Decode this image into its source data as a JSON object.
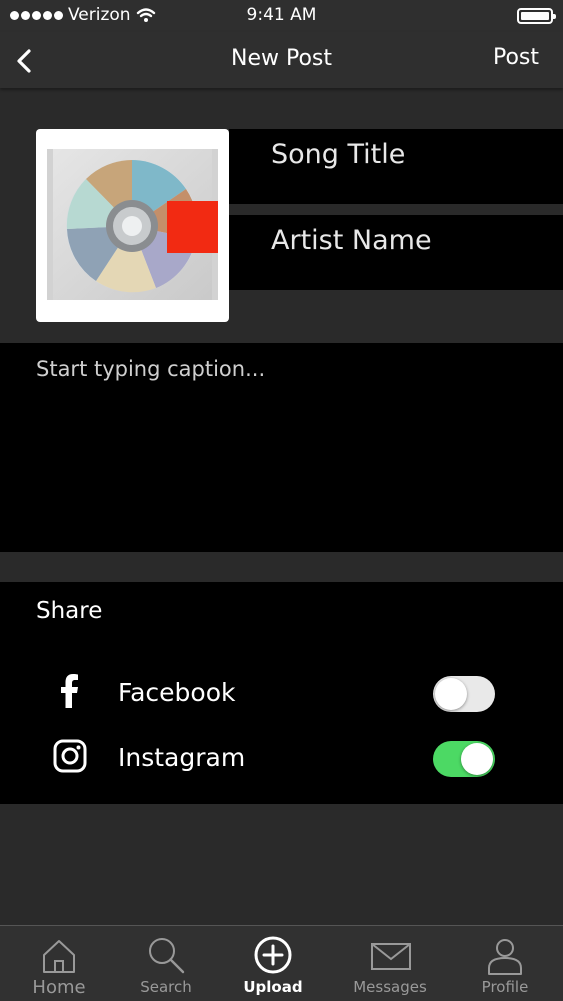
{
  "status_bar": {
    "carrier": "Verizon",
    "time": "9:41 AM",
    "signal_icon": "signal-dots-icon",
    "wifi_icon": "wifi-icon",
    "battery_icon": "battery-icon"
  },
  "nav": {
    "back_icon": "chevron-left-icon",
    "title": "New Post",
    "post_label": "Post"
  },
  "song": {
    "title_placeholder": "Song Title",
    "artist_placeholder": "Artist Name"
  },
  "caption": {
    "placeholder": "Start typing caption..."
  },
  "share": {
    "heading": "Share",
    "items": [
      {
        "label": "Facebook",
        "icon": "facebook-icon",
        "enabled": false
      },
      {
        "label": "Instagram",
        "icon": "instagram-icon",
        "enabled": true
      }
    ]
  },
  "tabs": [
    {
      "label": "Home",
      "icon": "home-icon",
      "active": false
    },
    {
      "label": "Search",
      "icon": "search-icon",
      "active": false
    },
    {
      "label": "Upload",
      "icon": "upload-plus-icon",
      "active": true
    },
    {
      "label": "Messages",
      "icon": "envelope-icon",
      "active": false
    },
    {
      "label": "Profile",
      "icon": "profile-icon",
      "active": false
    }
  ],
  "colors": {
    "background": "#2a2a2a",
    "panel": "#000000",
    "toggle_on": "#4cd964",
    "toggle_off": "#e9e9e9",
    "album_accent": "#f22a12"
  }
}
